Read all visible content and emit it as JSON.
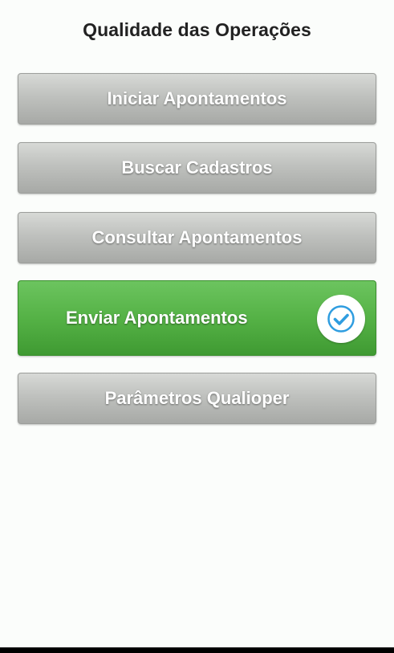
{
  "header": {
    "title": "Qualidade das Operações"
  },
  "menu": {
    "items": [
      {
        "label": "Iniciar Apontamentos"
      },
      {
        "label": "Buscar Cadastros"
      },
      {
        "label": "Consultar Apontamentos"
      },
      {
        "label": "Enviar Apontamentos",
        "state": "selected",
        "icon": "check-circle-icon"
      },
      {
        "label": "Parâmetros Qualioper"
      }
    ]
  },
  "colors": {
    "button_gray": "#bfc1be",
    "button_active_green": "#55b246",
    "check_blue": "#2f9de0",
    "text_title": "#222222"
  }
}
